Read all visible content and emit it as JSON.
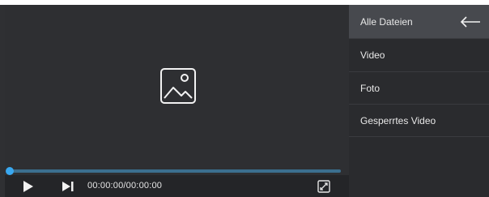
{
  "player": {
    "time_display": "00:00:00/00:00:00",
    "progress": 0,
    "icons": {
      "placeholder": "image-placeholder-icon",
      "play": "play-icon",
      "next": "skip-next-icon",
      "fullscreen": "fullscreen-icon"
    }
  },
  "menu": {
    "items": [
      {
        "label": "Alle Dateien",
        "active": true
      },
      {
        "label": "Video",
        "active": false
      },
      {
        "label": "Foto",
        "active": false
      },
      {
        "label": "Gesperrtes Video",
        "active": false
      }
    ],
    "back_icon": "back-arrow-icon"
  },
  "colors": {
    "accent": "#39a8f0",
    "background": "#2e2f32",
    "menu_active": "#47494e"
  }
}
